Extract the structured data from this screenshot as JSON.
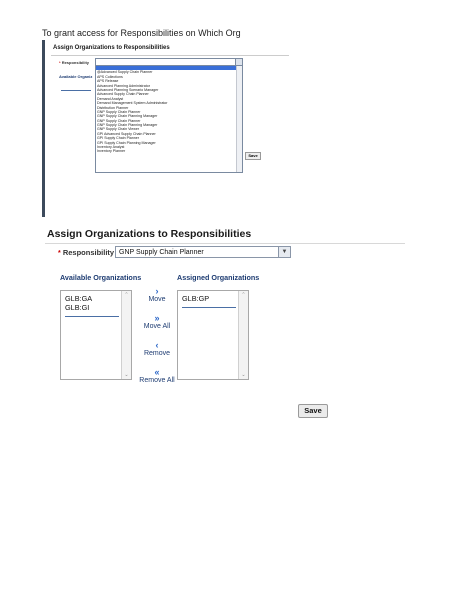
{
  "intro_text": "To grant access for Responsibilities on Which Org",
  "small_screenshot": {
    "title": "Assign Organizations to Responsibilities",
    "required_mark": "*",
    "responsibility_label": "Responsibility",
    "available_label": "Available Organiz",
    "selected_value": "",
    "options": [
      "",
      "@Advanced Supply Chain Planner",
      "APS Collections",
      "APS Release",
      "Advanced Planning Administrator",
      "Advanced Planning Scenario Manager",
      "Advanced Supply Chain Planner",
      "Demand Analyst",
      "Demand Management System Administrator",
      "Distribution Planner",
      "GNP Supply Chain Planner",
      "GNP Supply Chain Planning Manager",
      "GNP Supply Chain Planner",
      "GNP Supply Chain Planning Manager",
      "GNP Supply Chain Viewer",
      "GPI Advanced Supply Chain Planner",
      "GPI Supply Chain Planner",
      "GPI Supply Chain Planning Manager",
      "Inventory Analyst",
      "Inventory Planner"
    ],
    "save_label": "Save"
  },
  "main": {
    "title": "Assign Organizations to Responsibilities",
    "required_mark": "*",
    "responsibility_label": "Responsibility",
    "responsibility_value": "GNP Supply Chain Planner",
    "available_label": "Available Organizations",
    "assigned_label": "Assigned Organizations",
    "available_items": [
      "GLB:GA",
      "GLB:GI"
    ],
    "assigned_items": [
      "GLB:GP"
    ],
    "move_label": "Move",
    "move_all_label": "Move All",
    "remove_label": "Remove",
    "remove_all_label": "Remove All",
    "save_label": "Save"
  }
}
